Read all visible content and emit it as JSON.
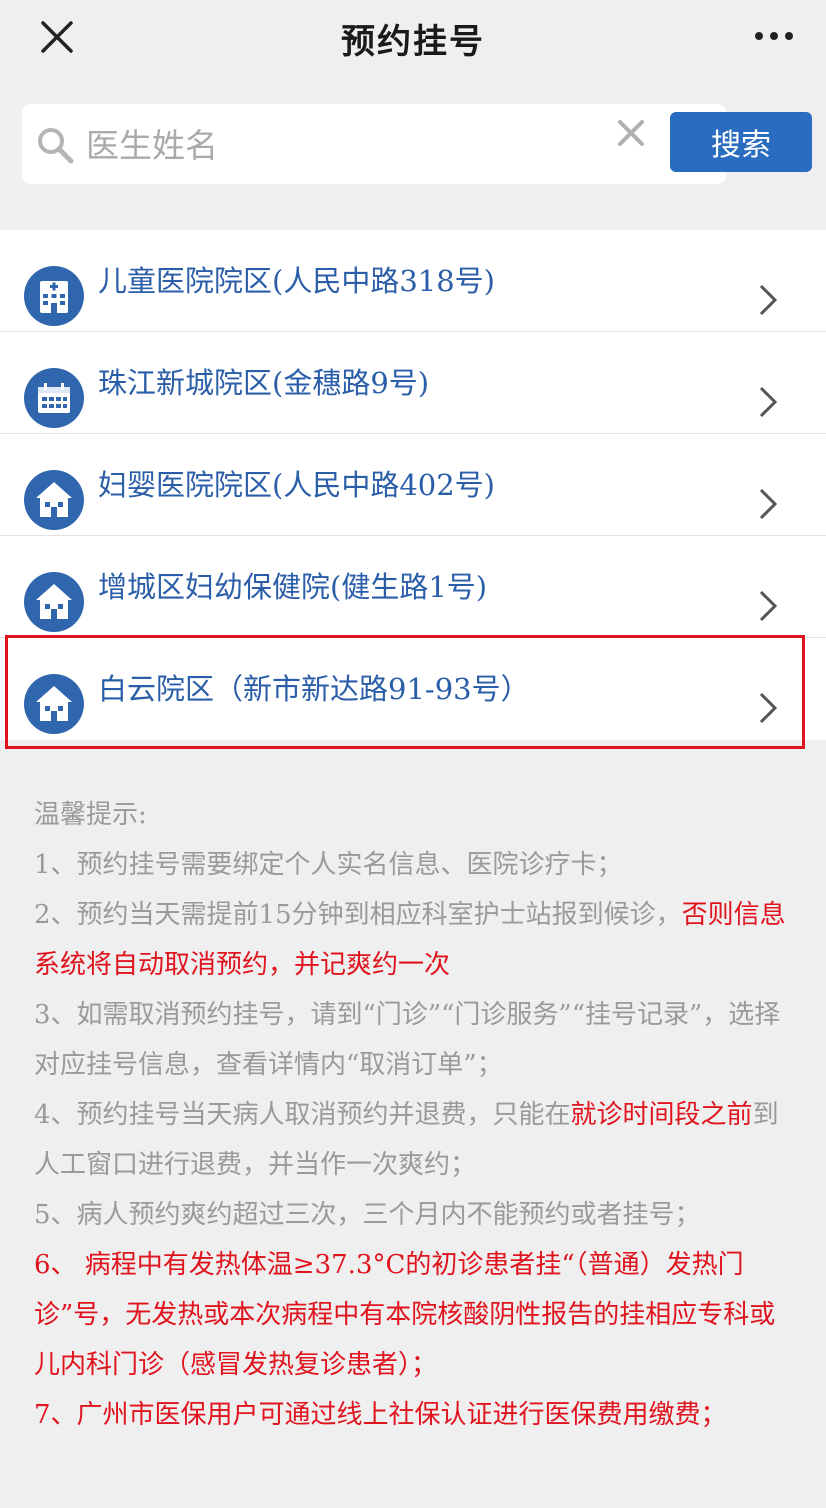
{
  "header": {
    "title": "预约挂号"
  },
  "search": {
    "placeholder": "医生姓名",
    "button_label": "搜索"
  },
  "campuses": [
    {
      "label": "儿童医院院区(人民中路318号)",
      "icon": "hospital-building-icon"
    },
    {
      "label": "珠江新城院区(金穗路9号)",
      "icon": "calendar-building-icon"
    },
    {
      "label": "妇婴医院院区(人民中路402号)",
      "icon": "house-icon"
    },
    {
      "label": "增城区妇幼保健院(健生路1号)",
      "icon": "house-icon"
    },
    {
      "label": "白云院区（新市新达路91-93号）",
      "icon": "house-icon"
    }
  ],
  "tips": {
    "title": "温馨提示:",
    "item1": "1、预约挂号需要绑定个人实名信息、医院诊疗卡；",
    "item2_a": "2、预约当天需提前15分钟到相应科室护士站报到候诊，",
    "item2_b": "否则信息系统将自动取消预约，并记爽约一次",
    "item3": "3、如需取消预约挂号，请到“门诊”“门诊服务”“挂号记录”，选择对应挂号信息，查看详情内“取消订单”；",
    "item4_a": "4、预约挂号当天病人取消预约并退费，只能在",
    "item4_b": "就诊时间段之前",
    "item4_c": "到人工窗口进行退费，并当作一次爽约；",
    "item5": "5、病人预约爽约超过三次，三个月内不能预约或者挂号；",
    "item6": "6、 病程中有发热体温≥37.3°C的初诊患者挂“（普通）发热门诊”号，无发热或本次病程中有本院核酸阴性报告的挂相应专科或儿内科门诊（感冒发热复诊患者）；",
    "item7": "7、广州市医保用户可通过线上社保认证进行医保费用缴费；"
  },
  "colors": {
    "accent": "#2a6cc0",
    "link": "#2b5ea8",
    "warning": "#e0141e",
    "muted": "#9a9a9a"
  }
}
